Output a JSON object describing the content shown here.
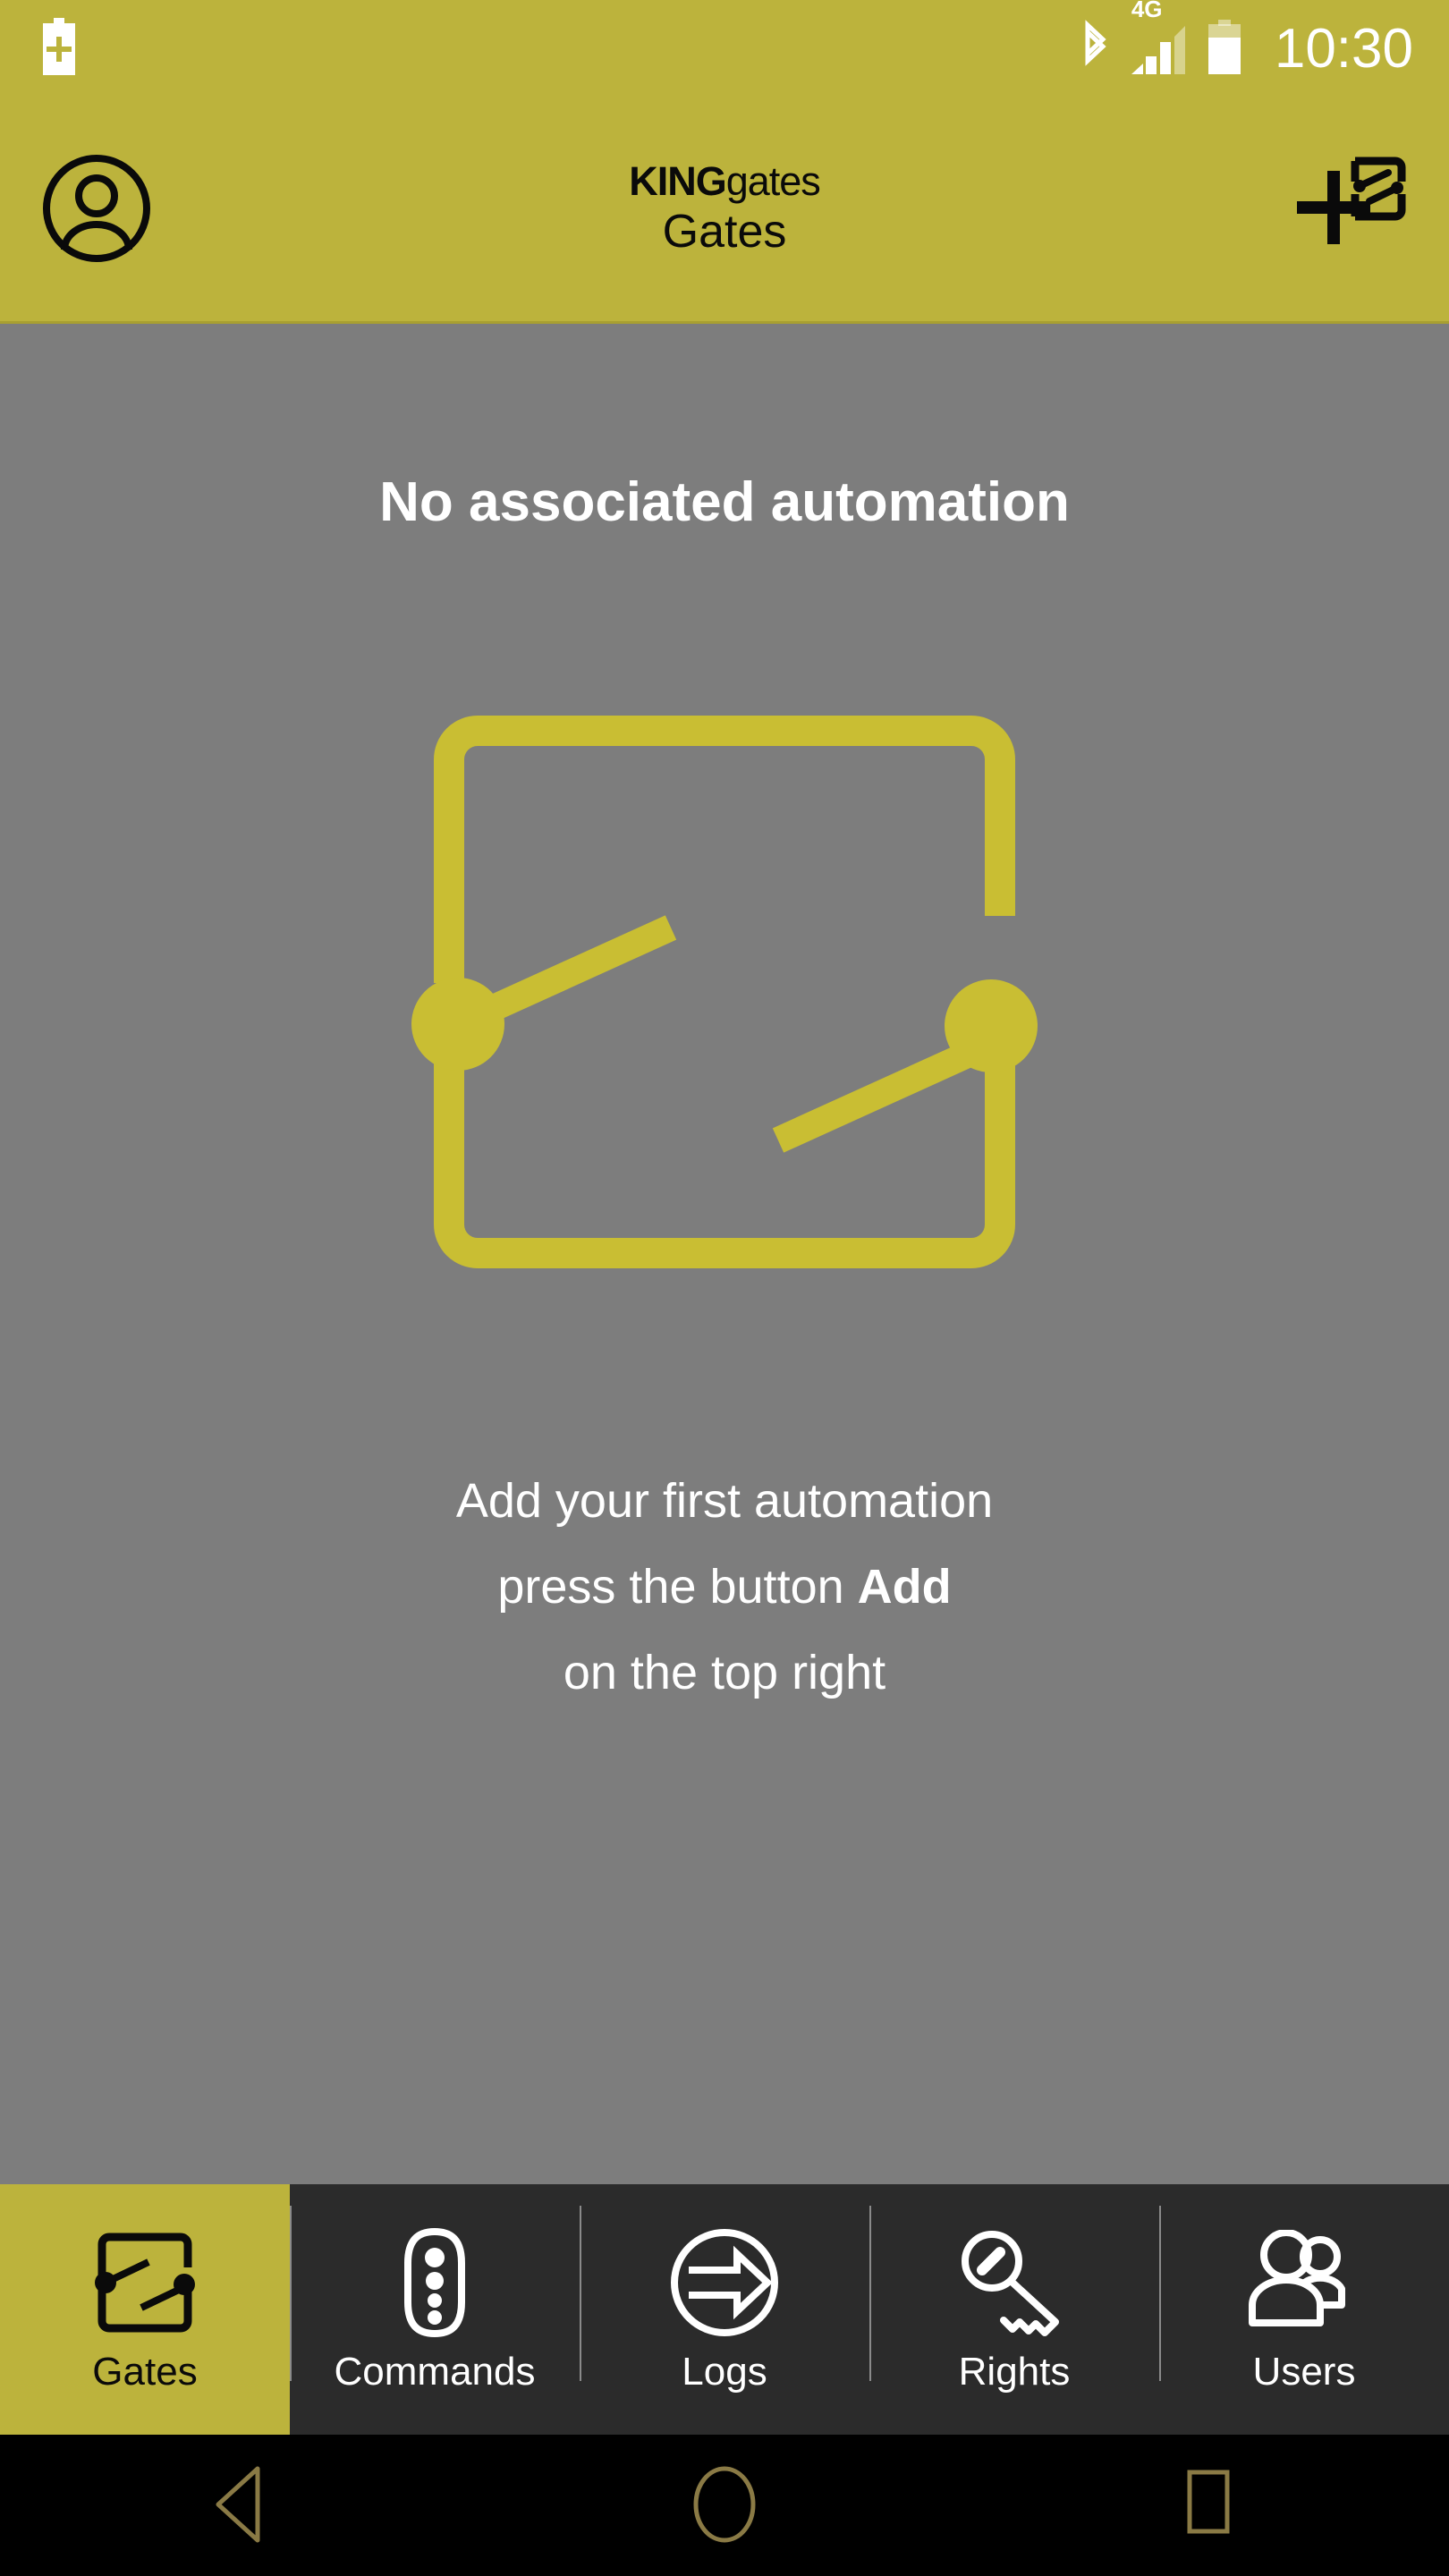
{
  "status_bar": {
    "battery_add_icon": "battery-plus-icon",
    "bluetooth_icon": "bluetooth-icon",
    "network_label": "4G",
    "signal_icon": "signal-bars-icon",
    "battery_icon": "battery-icon",
    "time": "10:30"
  },
  "header": {
    "profile_icon": "account-circle-icon",
    "brand_primary": "KING",
    "brand_secondary": "gates",
    "title": "Gates",
    "add_icon": "add-gate-icon"
  },
  "main": {
    "empty_title": "No associated automation",
    "illustration": "gate-automation-icon",
    "hint_line1": "Add your first automation",
    "hint_line2_prefix": "press the button",
    "hint_line2_bold": "Add",
    "hint_line3": "on the top right"
  },
  "tabbar": {
    "items": [
      {
        "label": "Gates",
        "icon": "gate-icon",
        "active": true
      },
      {
        "label": "Commands",
        "icon": "remote-icon",
        "active": false
      },
      {
        "label": "Logs",
        "icon": "logs-icon",
        "active": false
      },
      {
        "label": "Rights",
        "icon": "key-icon",
        "active": false
      },
      {
        "label": "Users",
        "icon": "users-icon",
        "active": false
      }
    ]
  },
  "sysnav": {
    "back_icon": "back-triangle-icon",
    "home_icon": "home-circle-icon",
    "recents_icon": "recents-square-icon"
  },
  "colors": {
    "brand_yellow": "#BCB33C",
    "content_gray": "#7D7D7D",
    "tabbar_dark": "#2B2B2B",
    "sysnav_black": "#000000",
    "icon_gold": "#8a7a45"
  }
}
